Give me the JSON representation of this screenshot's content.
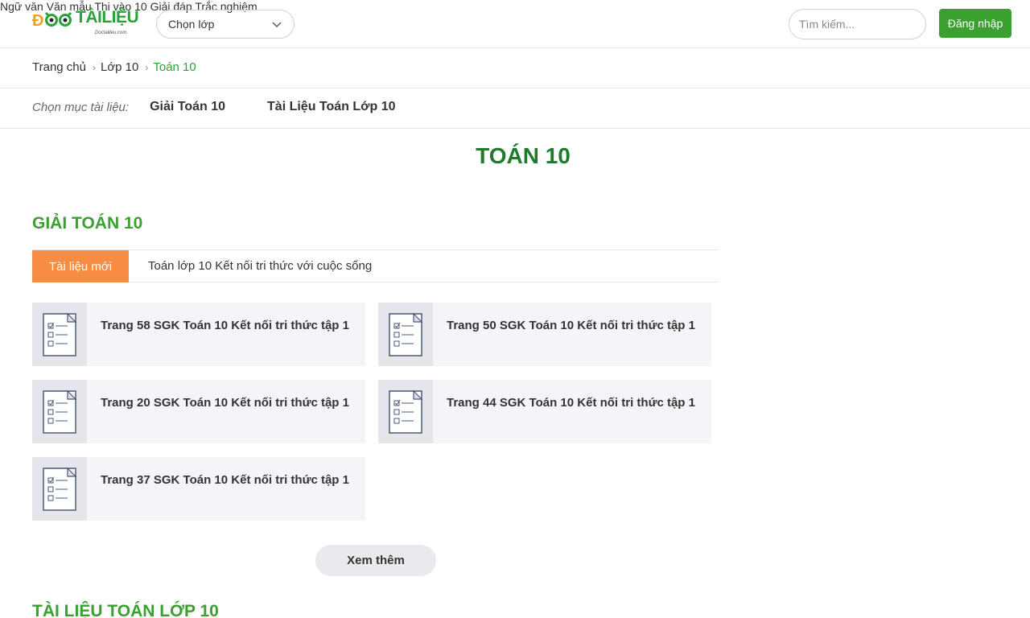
{
  "header": {
    "logo_text": "TÀILIỆU",
    "logo_sub": "Doctailieu.com",
    "class_select": "Chọn lớp",
    "nav": [
      "Ngữ văn",
      "Văn mẫu",
      "Thi vào 10",
      "Giải đáp",
      "Trắc nghiệm"
    ],
    "search_placeholder": "Tìm kiếm...",
    "login_label": "Đăng nhập"
  },
  "breadcrumb": [
    "Trang chủ",
    "Lớp 10",
    "Toán 10"
  ],
  "category": {
    "label": "Chọn mục tài liệu:",
    "links": [
      "Giải Toán 10",
      "Tài Liệu Toán Lớp 10"
    ]
  },
  "page_title": "TOÁN 10",
  "section1": {
    "title": "GIẢI TOÁN 10",
    "tab_new": "Tài liệu mới",
    "tab_link": "Toán lớp 10 Kết nối tri thức với cuộc sống",
    "items": [
      "Trang 58 SGK Toán 10 Kết nối tri thức tập 1",
      "Trang 50 SGK Toán 10 Kết nối tri thức tập 1",
      "Trang 20 SGK Toán 10 Kết nối tri thức tập 1",
      "Trang 44 SGK Toán 10 Kết nối tri thức tập 1",
      "Trang 37 SGK Toán 10 Kết nối tri thức tập 1"
    ],
    "more_label": "Xem thêm"
  },
  "section2": {
    "title": "TÀI LIỆU TOÁN LỚP 10"
  },
  "colors": {
    "brand_green": "#3aa02f",
    "title_green": "#1f7a2e",
    "tab_orange": "#f58d45"
  }
}
